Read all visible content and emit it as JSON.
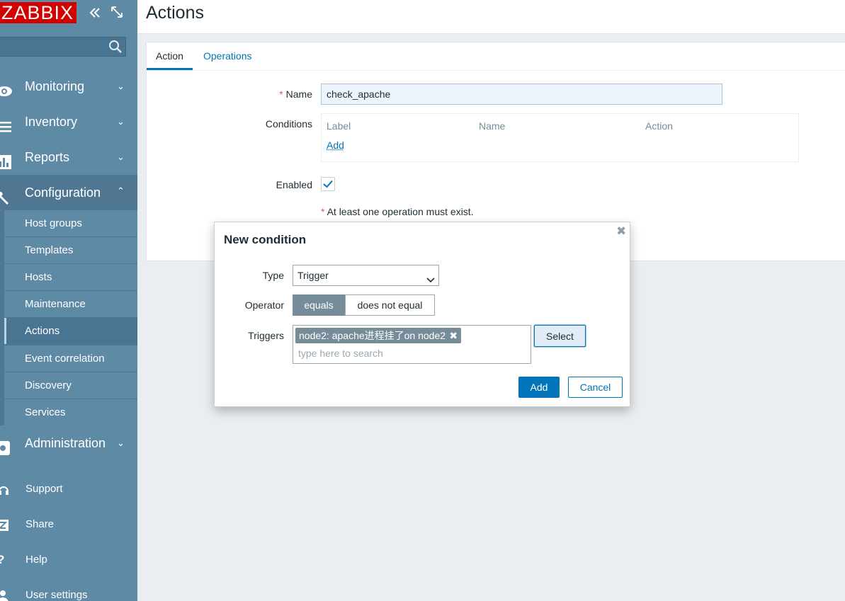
{
  "sidebar": {
    "logo": "ZABBIX",
    "collapse_icon": "double-chevron-left-icon",
    "kiosk_icon": "expand-icon",
    "search_placeholder": "",
    "menu": [
      {
        "label": "Monitoring",
        "icon": "eye-icon",
        "expanded": false
      },
      {
        "label": "Inventory",
        "icon": "list-icon",
        "expanded": false
      },
      {
        "label": "Reports",
        "icon": "bar-chart-icon",
        "expanded": false
      },
      {
        "label": "Configuration",
        "icon": "wrench-icon",
        "expanded": true
      },
      {
        "label": "Administration",
        "icon": "gear-icon",
        "expanded": false
      }
    ],
    "submenu": [
      "Host groups",
      "Templates",
      "Hosts",
      "Maintenance",
      "Actions",
      "Event correlation",
      "Discovery",
      "Services"
    ],
    "active_submenu": "Actions",
    "footer": [
      {
        "label": "Support",
        "icon": "headset-icon"
      },
      {
        "label": "Share",
        "icon": "share-z-icon"
      },
      {
        "label": "Help",
        "icon": "question-icon"
      },
      {
        "label": "User settings",
        "icon": "user-icon"
      }
    ]
  },
  "header": {
    "title": "Actions"
  },
  "tabs": [
    {
      "label": "Action",
      "active": true
    },
    {
      "label": "Operations",
      "active": false
    }
  ],
  "form": {
    "name_label": "Name",
    "required_mark": "*",
    "name_value": "check_apache",
    "conditions_label": "Conditions",
    "conditions_headers": [
      "Label",
      "Name",
      "Action"
    ],
    "conditions_add": "Add",
    "enabled_label": "Enabled",
    "enabled": true,
    "warning": "At least one operation must exist."
  },
  "modal": {
    "title": "New condition",
    "close_icon": "close-icon",
    "type_label": "Type",
    "type_value": "Trigger",
    "operator_label": "Operator",
    "operator_options": [
      "equals",
      "does not equal"
    ],
    "operator_selected": "equals",
    "triggers_label": "Triggers",
    "trigger_chip": "node2: apache进程挂了on node2",
    "trigger_search_placeholder": "type here to search",
    "select_button": "Select",
    "add_button": "Add",
    "cancel_button": "Cancel"
  },
  "colors": {
    "sidebar_bg": "#5e8aa6",
    "brand_red": "#d40000",
    "accent_blue": "#0275b8",
    "chip_bg": "#768d99"
  }
}
